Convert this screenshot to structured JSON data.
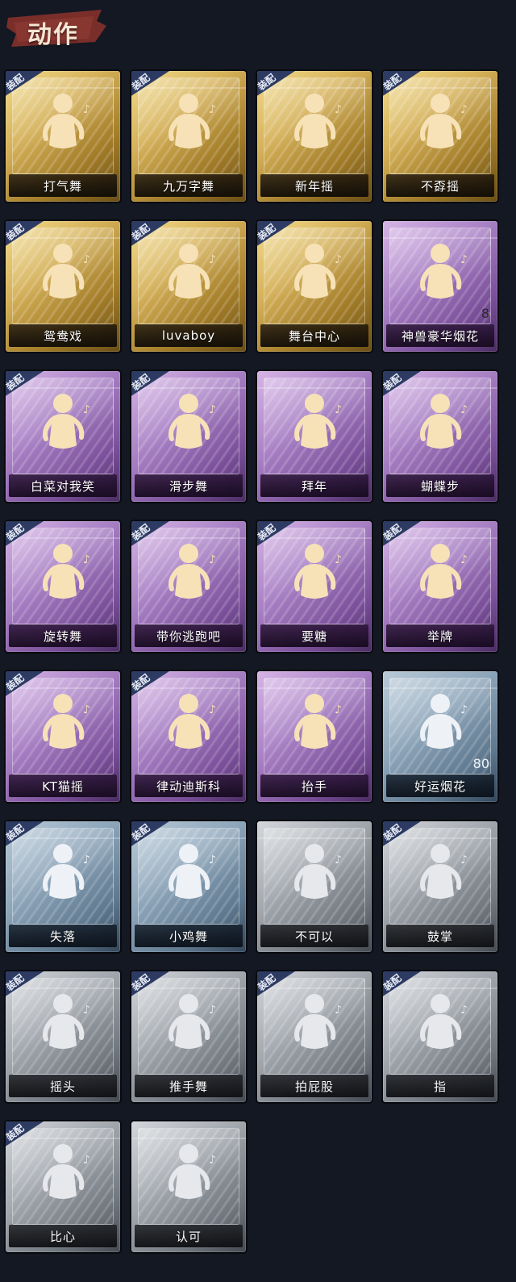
{
  "section_title": "动作",
  "equip_label": "装配",
  "items": [
    {
      "name": "打气舞",
      "rarity": "gold",
      "equipped": true,
      "icon": "cheer-dance-icon"
    },
    {
      "name": "九万字舞",
      "rarity": "gold",
      "equipped": true,
      "icon": "ninety-thousand-dance-icon"
    },
    {
      "name": "新年摇",
      "rarity": "gold",
      "equipped": true,
      "icon": "new-year-shake-icon"
    },
    {
      "name": "不孬摇",
      "rarity": "gold",
      "equipped": true,
      "icon": "not-bad-shake-icon"
    },
    {
      "name": "鸳鸯戏",
      "rarity": "gold",
      "equipped": true,
      "icon": "mandarin-duck-icon"
    },
    {
      "name": "luvaboy",
      "rarity": "gold",
      "equipped": true,
      "icon": "luvaboy-icon"
    },
    {
      "name": "舞台中心",
      "rarity": "gold",
      "equipped": true,
      "icon": "stage-center-icon"
    },
    {
      "name": "神兽豪华烟花",
      "rarity": "purple",
      "equipped": false,
      "icon": "fireworks-pot-icon",
      "count": "8"
    },
    {
      "name": "白菜对我笑",
      "rarity": "purple",
      "equipped": true,
      "icon": "cabbage-smile-icon"
    },
    {
      "name": "滑步舞",
      "rarity": "purple",
      "equipped": true,
      "icon": "slide-dance-icon"
    },
    {
      "name": "拜年",
      "rarity": "purple",
      "equipped": false,
      "icon": "new-year-greeting-icon"
    },
    {
      "name": "蝴蝶步",
      "rarity": "purple",
      "equipped": true,
      "icon": "butterfly-step-icon"
    },
    {
      "name": "旋转舞",
      "rarity": "purple",
      "equipped": true,
      "icon": "spin-dance-icon"
    },
    {
      "name": "带你逃跑吧",
      "rarity": "purple",
      "equipped": true,
      "icon": "run-away-icon"
    },
    {
      "name": "要糖",
      "rarity": "purple",
      "equipped": true,
      "icon": "ask-candy-icon"
    },
    {
      "name": "举牌",
      "rarity": "purple",
      "equipped": true,
      "icon": "hold-sign-icon"
    },
    {
      "name": "KT猫摇",
      "rarity": "purple",
      "equipped": true,
      "icon": "kt-cat-shake-icon"
    },
    {
      "name": "律动迪斯科",
      "rarity": "purple",
      "equipped": true,
      "icon": "disco-icon"
    },
    {
      "name": "抬手",
      "rarity": "purple",
      "equipped": false,
      "icon": "raise-hand-icon"
    },
    {
      "name": "好运烟花",
      "rarity": "blue",
      "equipped": false,
      "icon": "lucky-fireworks-icon",
      "count": "80"
    },
    {
      "name": "失落",
      "rarity": "blue",
      "equipped": true,
      "icon": "dejected-icon"
    },
    {
      "name": "小鸡舞",
      "rarity": "blue",
      "equipped": true,
      "icon": "chicken-dance-icon"
    },
    {
      "name": "不可以",
      "rarity": "grey",
      "equipped": false,
      "icon": "wag-finger-icon"
    },
    {
      "name": "鼓掌",
      "rarity": "grey",
      "equipped": true,
      "icon": "clap-icon"
    },
    {
      "name": "摇头",
      "rarity": "grey",
      "equipped": true,
      "icon": "shake-head-icon"
    },
    {
      "name": "推手舞",
      "rarity": "grey",
      "equipped": true,
      "icon": "push-hands-dance-icon"
    },
    {
      "name": "拍屁股",
      "rarity": "grey",
      "equipped": true,
      "icon": "pat-butt-icon"
    },
    {
      "name": "指",
      "rarity": "grey",
      "equipped": true,
      "icon": "point-icon"
    },
    {
      "name": "比心",
      "rarity": "grey",
      "equipped": true,
      "icon": "finger-heart-icon"
    },
    {
      "name": "认可",
      "rarity": "grey",
      "equipped": false,
      "icon": "thumbs-up-icon"
    }
  ]
}
